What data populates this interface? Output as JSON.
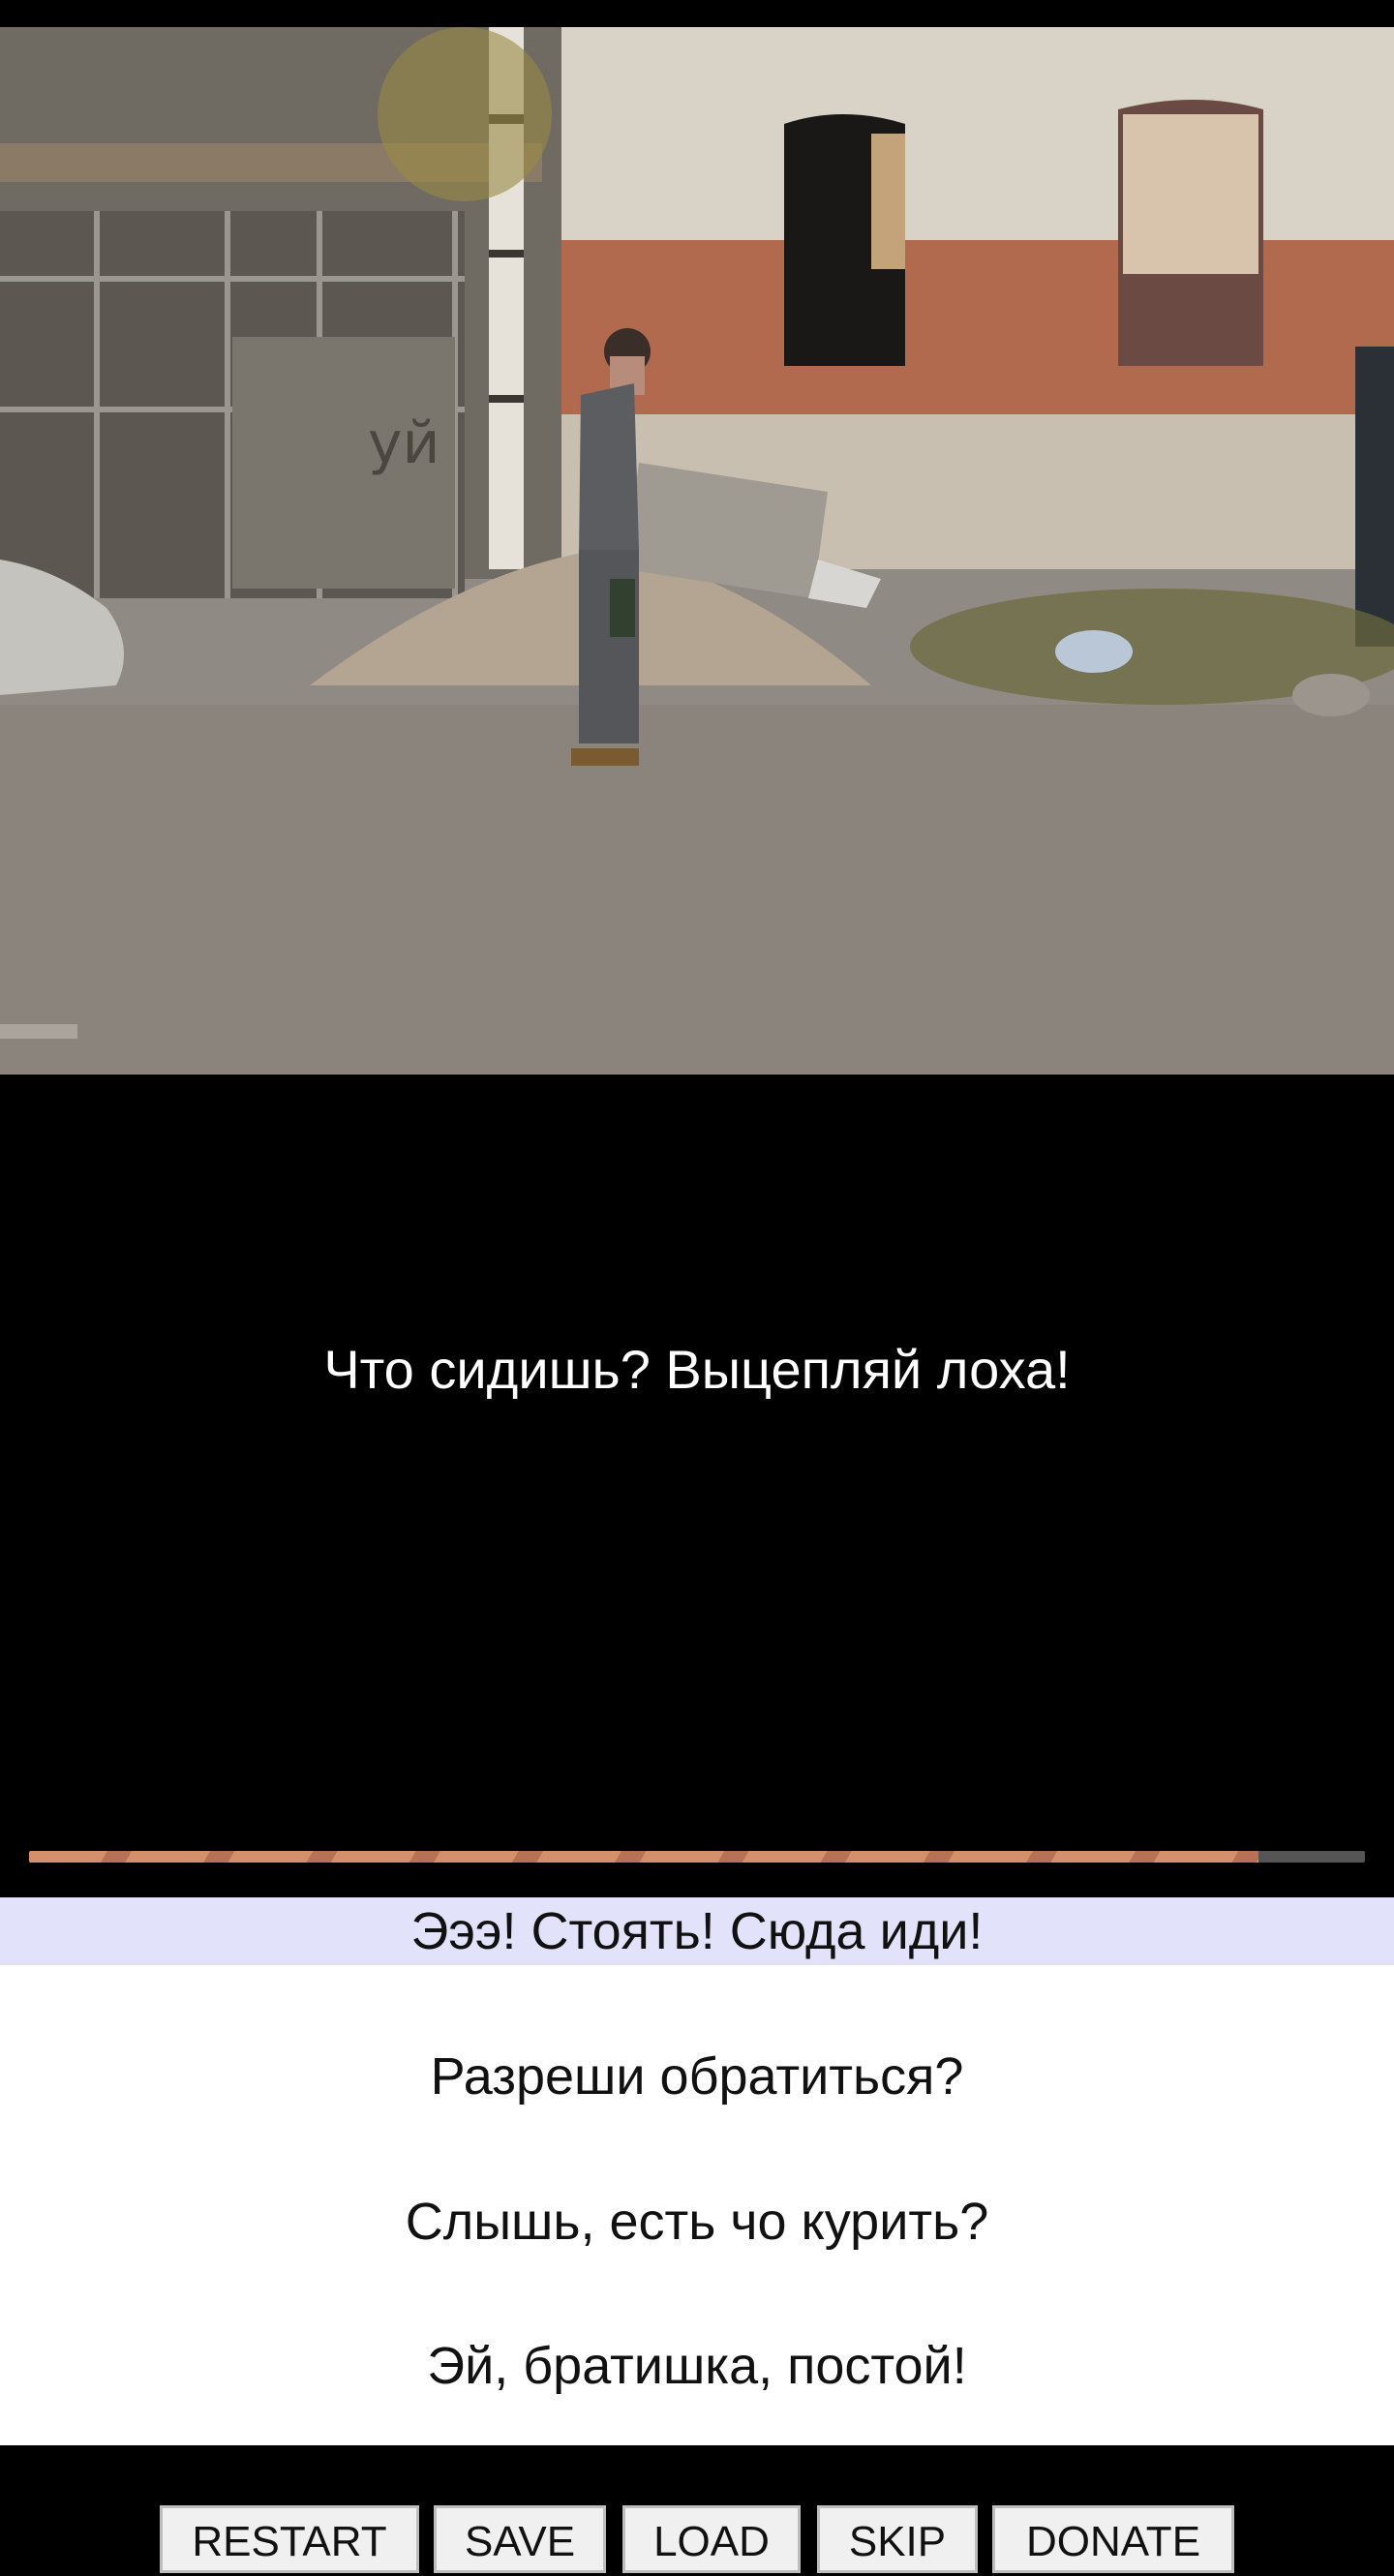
{
  "scene": {
    "graffiti_text": "уй"
  },
  "narration": {
    "text": "Что сидишь? Выцепляй лоха!"
  },
  "timer": {
    "progress": 0.92
  },
  "choices": [
    {
      "label": "Эээ! Стоять! Сюда иди!",
      "selected": true
    },
    {
      "label": "Разреши обратиться?",
      "selected": false
    },
    {
      "label": "Слышь, есть чо курить?",
      "selected": false
    },
    {
      "label": "Эй, братишка, постой!",
      "selected": false
    }
  ],
  "buttons": {
    "restart": "RESTART",
    "save": "SAVE",
    "load": "LOAD",
    "skip": "SKIP",
    "donate": "DONATE"
  },
  "colors": {
    "selected_choice_bg": "#e3e2fb",
    "timer_fill": "#d4906a"
  }
}
